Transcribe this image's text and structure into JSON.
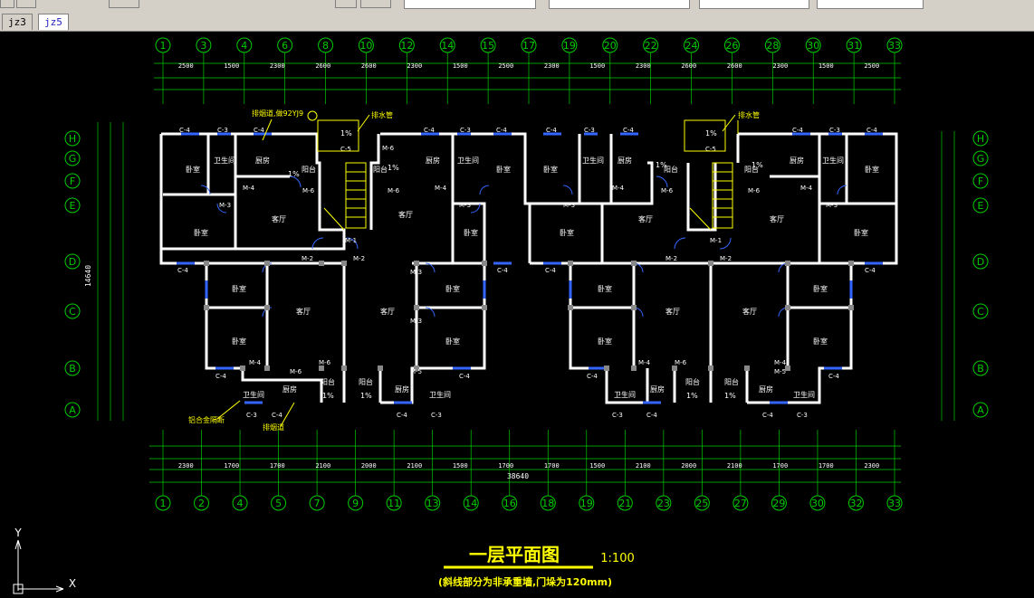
{
  "tabs": [
    {
      "label": "jz3",
      "active": false
    },
    {
      "label": "jz5",
      "active": true
    }
  ],
  "drawing": {
    "title": "一层平面图",
    "scale": "1:100",
    "note": "(斜线部分为非承重墙,门垛为120mm)",
    "top_axes": [
      "1",
      "3",
      "4",
      "6",
      "8",
      "10",
      "12",
      "14",
      "15",
      "17",
      "19",
      "20",
      "22",
      "24",
      "26",
      "28",
      "30",
      "31",
      "33"
    ],
    "bottom_axes": [
      "1",
      "2",
      "4",
      "5",
      "7",
      "9",
      "11",
      "13",
      "14",
      "16",
      "18",
      "19",
      "21",
      "23",
      "25",
      "27",
      "29",
      "30",
      "32",
      "33"
    ],
    "row_axes": [
      "H",
      "G",
      "F",
      "E",
      "D",
      "C",
      "B",
      "A"
    ],
    "top_dims_row1": [
      "2500",
      "1500",
      "2300",
      "2600",
      "2600",
      "2300",
      "1500",
      "2500",
      "2300",
      "1500",
      "2300",
      "2600",
      "2600",
      "2300",
      "1500",
      "2500"
    ],
    "bottom_dims_row2": [
      "2300",
      "1700",
      "1700",
      "2100",
      "2000",
      "2100",
      "1500",
      "1700",
      "1700",
      "1500",
      "2100",
      "2000",
      "2100",
      "1700",
      "1700",
      "2300"
    ],
    "total_width": "38640",
    "left_total": "14640",
    "room_labels": [
      "卧室",
      "卫生间",
      "厨房",
      "阳台",
      "客厅",
      "楼梯间",
      "卧室",
      "卧室",
      "客厅",
      "卧室",
      "卧室",
      "厨房",
      "卫生间",
      "阳台",
      "阳台",
      "厨房",
      "卫生间"
    ],
    "door_labels": [
      "M-4",
      "M-3",
      "M-2",
      "M-5",
      "M-6",
      "M-1"
    ],
    "window_labels": [
      "C-4",
      "C-3",
      "C-5"
    ],
    "annotations": [
      "排烟道,做92YJ9",
      "排水管",
      "铝合金隔断",
      "排烟道",
      "1%",
      "1%"
    ],
    "ucs": {
      "y": "Y",
      "x": "X"
    }
  }
}
